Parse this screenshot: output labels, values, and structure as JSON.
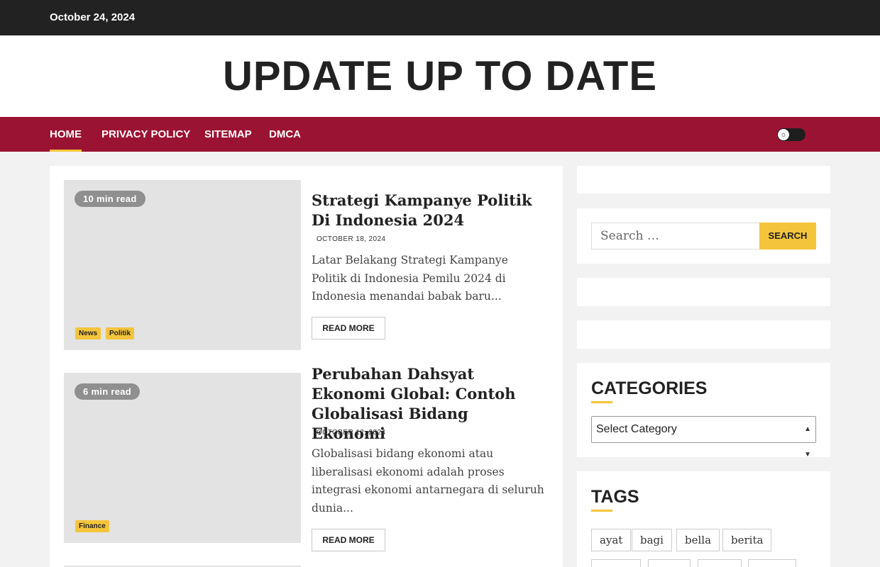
{
  "topbar": {
    "date": "October 24, 2024"
  },
  "site": {
    "title": "UPDATE UP TO DATE"
  },
  "nav": {
    "items": [
      "HOME",
      "PRIVACY POLICY",
      "SITEMAP",
      "DMCA"
    ]
  },
  "theme_toggle": {
    "icon": "sun-icon",
    "glyph": "☼"
  },
  "posts": [
    {
      "read_time": "10 min read",
      "categories": [
        "News",
        "Politik"
      ],
      "title": "Strategi Kampanye Politik Di Indonesia 2024",
      "date": "OCTOBER 18, 2024",
      "excerpt": "Latar Belakang Strategi Kampanye Politik di Indonesia Pemilu 2024 di Indonesia menandai babak baru...",
      "read_more": "READ MORE"
    },
    {
      "read_time": "6 min read",
      "categories": [
        "Finance"
      ],
      "title": "Perubahan Dahsyat Ekonomi Global: Contoh Globalisasi Bidang Ekonomi",
      "date": "OCTOBER 12, 2024",
      "excerpt": "Globalisasi bidang ekonomi atau liberalisasi ekonomi adalah proses integrasi ekonomi antarnegara di seluruh dunia...",
      "read_more": "READ MORE"
    }
  ],
  "sidebar": {
    "search": {
      "placeholder": "Search …",
      "button": "SEARCH"
    },
    "categories": {
      "title": "CATEGORIES",
      "selected": "Select Category"
    },
    "tags": {
      "title": "TAGS",
      "items": [
        "ayat",
        "bagi",
        "bella",
        "berita"
      ]
    }
  },
  "colors": {
    "accent": "#f4c53a",
    "nav_bg": "#9b1332",
    "topbar_bg": "#222222"
  }
}
